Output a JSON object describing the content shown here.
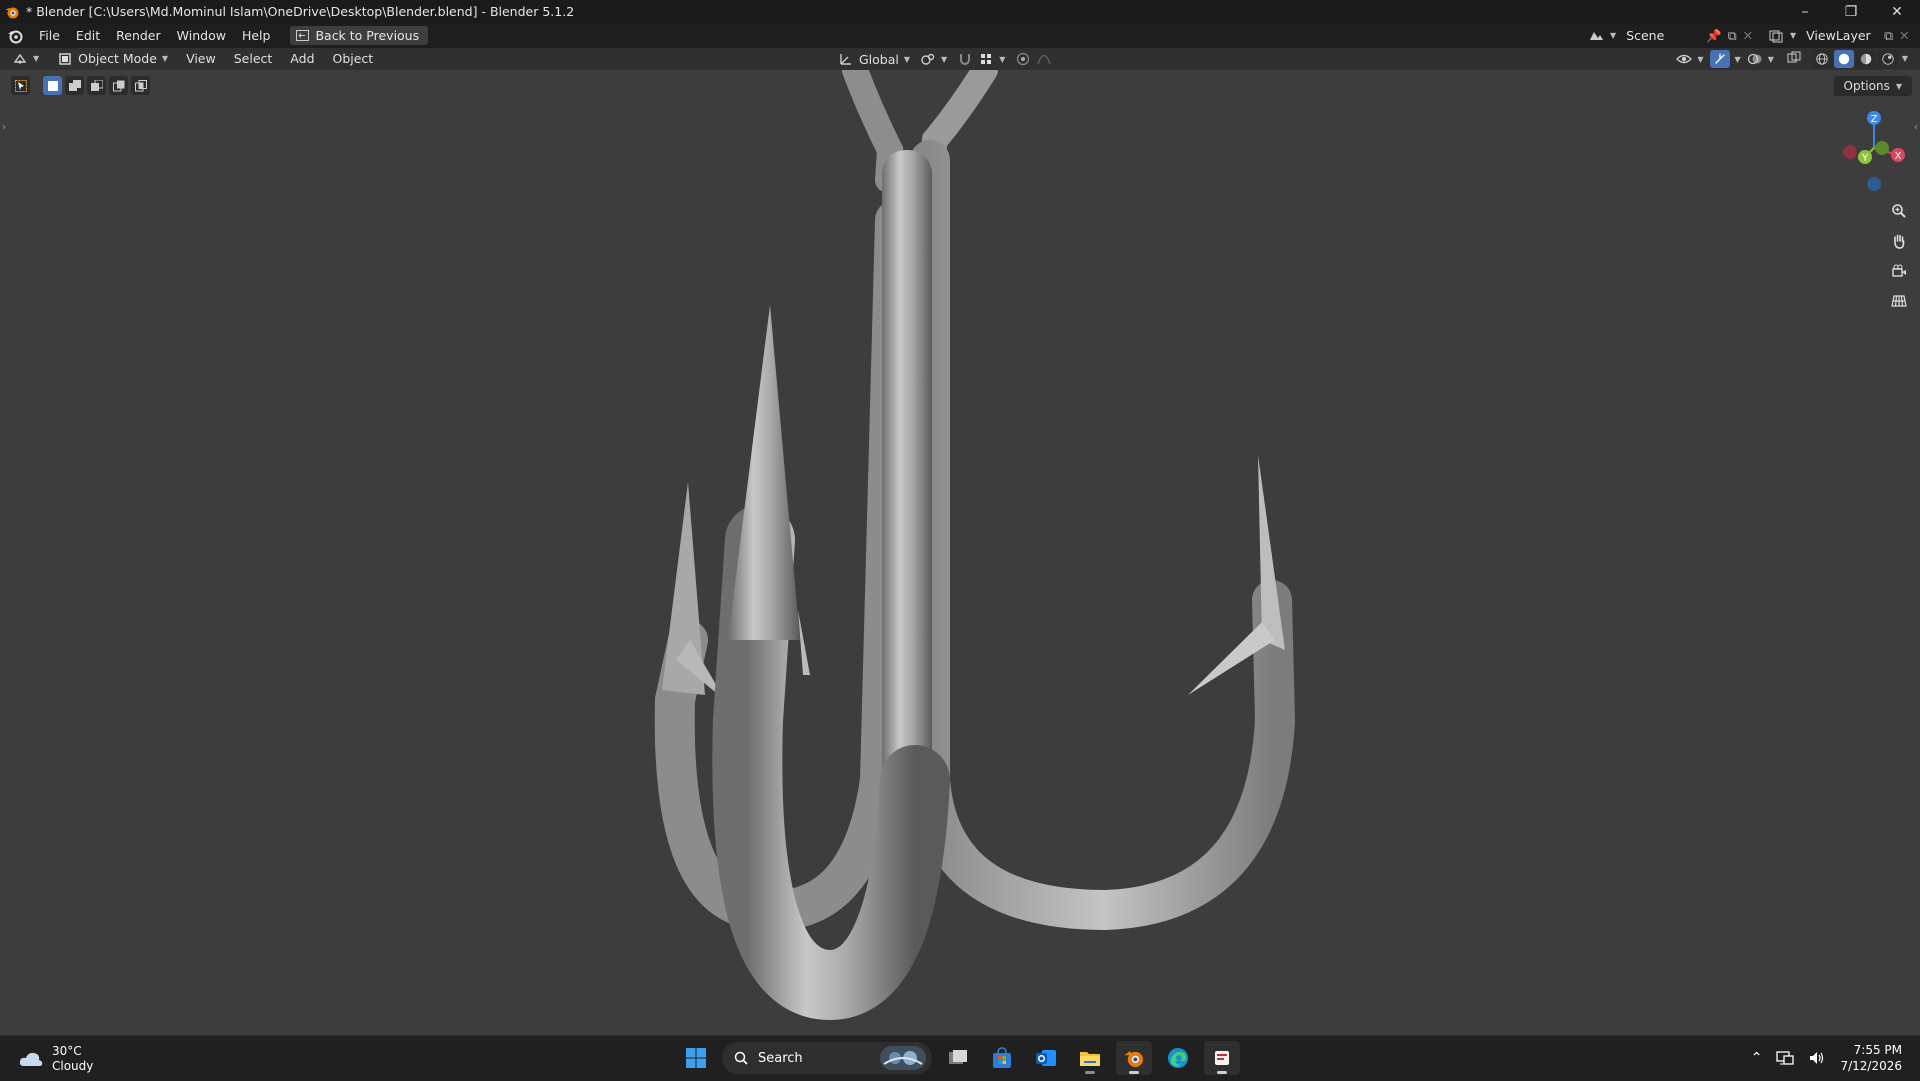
{
  "window": {
    "title": "* Blender [C:\\Users\\Md.Mominul Islam\\OneDrive\\Desktop\\Blender.blend] - Blender 5.1.2",
    "controls": [
      "minimize-icon",
      "restore-icon",
      "close-icon"
    ]
  },
  "menubar": {
    "items": [
      "File",
      "Edit",
      "Render",
      "Window",
      "Help"
    ],
    "back_button": "Back to Previous",
    "scene": "Scene",
    "view_layer": "ViewLayer"
  },
  "viewport_header": {
    "mode": "Object Mode",
    "menus": [
      "View",
      "Select",
      "Add",
      "Object"
    ],
    "orientation": "Global"
  },
  "viewport": {
    "options_label": "Options",
    "gizmo_axes": [
      "Z",
      "Y",
      "X"
    ],
    "axis_colors": {
      "x": "#e0445e",
      "y": "#8cc43a",
      "z": "#3d88e3"
    },
    "nav_icons": [
      "zoom-icon",
      "pan-hand-icon",
      "camera-icon",
      "grid-icon"
    ]
  },
  "taskbar": {
    "weather_temp": "30°C",
    "weather_desc": "Cloudy",
    "search_placeholder": "Search",
    "apps": [
      "windows-start-icon",
      "search",
      "task-view-icon",
      "microsoft-store-icon",
      "outlook-icon",
      "file-explorer-icon",
      "blender-icon",
      "edge-icon",
      "app-icon"
    ],
    "time": "7:55 PM",
    "date": "7/12/2026"
  },
  "colors": {
    "viewport_bg": "#3d3d3d",
    "header_bg": "#303030",
    "accent": "#4772b3",
    "blender_orange": "#e87d0d"
  }
}
